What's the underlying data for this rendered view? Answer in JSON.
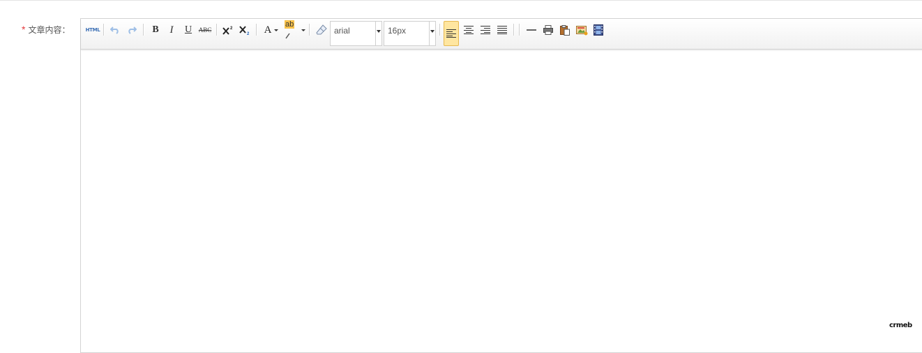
{
  "form": {
    "required_mark": "*",
    "label": "文章内容："
  },
  "toolbar": {
    "html_label": "HTML",
    "bold_label": "B",
    "italic_label": "I",
    "underline_label": "U",
    "strike_label": "ABC",
    "forecolor_label": "A",
    "backcolor_label": "ab",
    "font_family": {
      "value": "arial"
    },
    "font_size": {
      "value": "16px"
    }
  },
  "editor": {
    "content": "",
    "brand_mark": "crmeb"
  },
  "colors": {
    "required": "#e4393c",
    "active_align_bg": "#ffe6a0",
    "active_align_border": "#e6b84f"
  }
}
